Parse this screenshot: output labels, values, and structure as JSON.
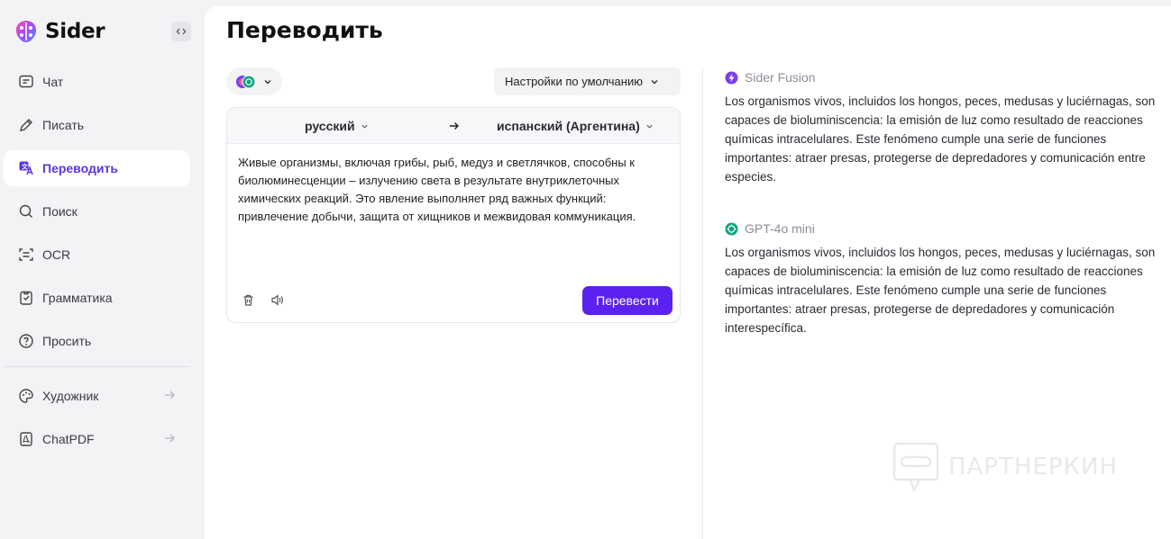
{
  "app": {
    "name": "Sider"
  },
  "sidebar": {
    "items": [
      {
        "label": "Чат",
        "icon": "chat-icon",
        "active": false
      },
      {
        "label": "Писать",
        "icon": "pen-icon",
        "active": false
      },
      {
        "label": "Переводить",
        "icon": "translate-icon",
        "active": true
      },
      {
        "label": "Поиск",
        "icon": "search-icon",
        "active": false
      },
      {
        "label": "OCR",
        "icon": "ocr-icon",
        "active": false
      },
      {
        "label": "Грамматика",
        "icon": "grammar-icon",
        "active": false
      },
      {
        "label": "Просить",
        "icon": "ask-icon",
        "active": false
      }
    ],
    "tools": [
      {
        "label": "Художник",
        "icon": "artist-icon"
      },
      {
        "label": "ChatPDF",
        "icon": "pdf-icon"
      }
    ]
  },
  "main": {
    "title": "Переводить",
    "settings_label": "Настройки по умолчанию",
    "source_lang": "русский",
    "target_lang": "испанский (Аргентина)",
    "source_text": "Живые организмы, включая грибы, рыб, медуз и светлячков, способны к биолюминесценции – излучению света в результате внутриклеточных химических реакций. Это явление выполняет ряд важных функций: привлечение добычи, защита от хищников и межвидовая коммуникация.",
    "translate_button": "Перевести"
  },
  "results": [
    {
      "model": "Sider Fusion",
      "text": "Los organismos vivos, incluidos los hongos, peces, medusas y luciérnagas, son capaces de bioluminiscencia: la emisión de luz como resultado de reacciones químicas intracelulares. Este fenómeno cumple una serie de funciones importantes: atraer presas, protegerse de depredadores y comunicación entre especies."
    },
    {
      "model": "GPT-4o mini",
      "text": "Los organismos vivos, incluidos los hongos, peces, medusas y luciérnagas, son capaces de bioluminiscencia: la emisión de luz como resultado de reacciones químicas intracelulares. Este fenómeno cumple una serie de funciones importantes: atraer presas, protegerse de depredadores y comunicación interespecífica."
    }
  ],
  "watermark": "ПАРТНЕРКИН",
  "colors": {
    "accent": "#5b21ee",
    "active_text": "#5b35e0",
    "sidebar_bg": "#f3f3f6"
  }
}
